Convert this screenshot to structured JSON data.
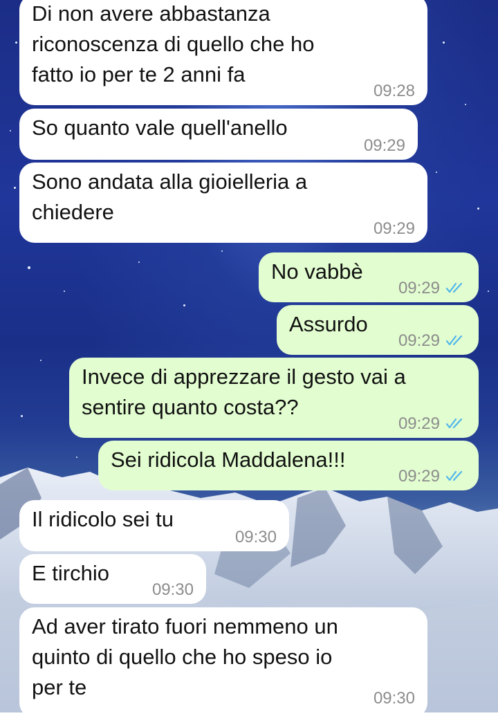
{
  "chat": {
    "messages": [
      {
        "direction": "incoming",
        "text": "Di non avere abbastanza\nriconoscenza di quello che ho\nfatto io per te 2 anni fa",
        "time": "09:28"
      },
      {
        "direction": "incoming",
        "text": "So quanto vale quell'anello",
        "time": "09:29"
      },
      {
        "direction": "incoming",
        "text": "Sono andata alla gioielleria a\nchiedere",
        "time": "09:29"
      },
      {
        "direction": "outgoing",
        "text": "No vabbè",
        "time": "09:29",
        "status": "read"
      },
      {
        "direction": "outgoing",
        "text": "Assurdo",
        "time": "09:29",
        "status": "read"
      },
      {
        "direction": "outgoing",
        "text": "Invece di apprezzare il gesto vai a\nsentire quanto costa??",
        "time": "09:29",
        "status": "read"
      },
      {
        "direction": "outgoing",
        "text": "Sei ridicola Maddalena!!!",
        "time": "09:29",
        "status": "read"
      },
      {
        "direction": "incoming",
        "text": "Il ridicolo sei tu",
        "time": "09:30"
      },
      {
        "direction": "incoming",
        "text": "E tirchio",
        "time": "09:30"
      },
      {
        "direction": "incoming",
        "text": "Ad aver tirato fuori nemmeno un\nquinto di quello che ho speso io\nper te",
        "time": "09:30"
      }
    ]
  },
  "colors": {
    "incoming_bubble": "#ffffff",
    "outgoing_bubble": "#e2fdd0",
    "read_ticks": "#4fb6ec",
    "timestamp": "#8c8c8c"
  },
  "icons": {
    "read_receipt": "double-check-icon"
  }
}
